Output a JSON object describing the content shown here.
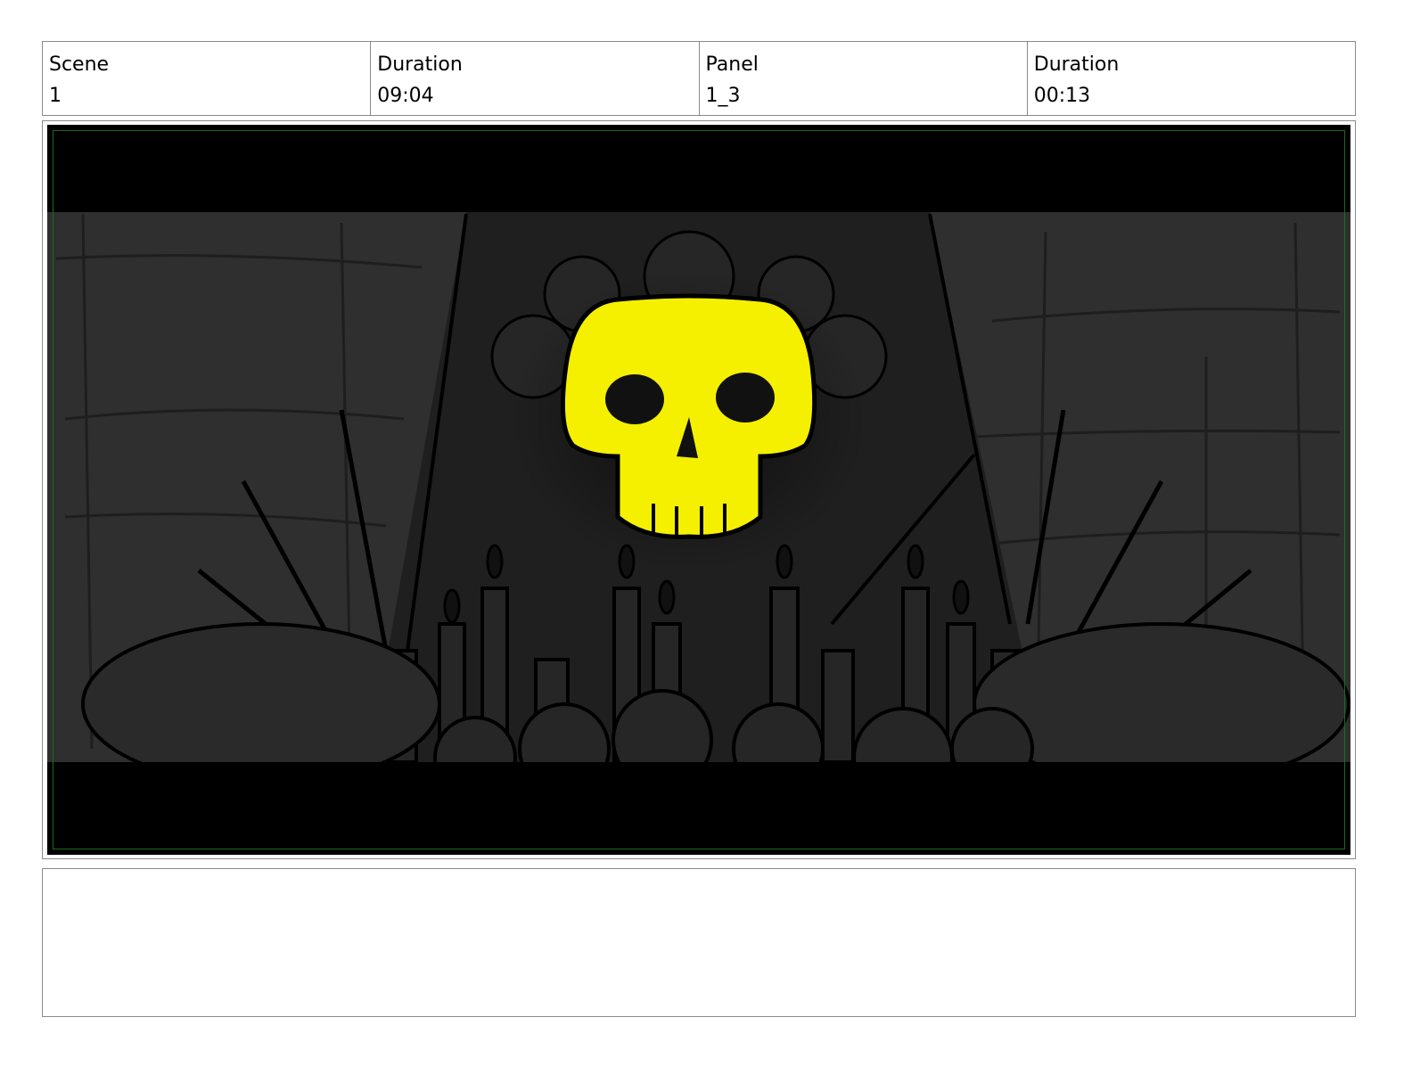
{
  "header": {
    "cells": [
      {
        "label": "Scene",
        "value": "1"
      },
      {
        "label": "Duration",
        "value": "09:04"
      },
      {
        "label": "Panel",
        "value": "1_3"
      },
      {
        "label": "Duration",
        "value": "00:13"
      }
    ]
  },
  "frame": {
    "image_subject": "yellow-skull-altar-icon"
  },
  "notes": {
    "text": ""
  },
  "colors": {
    "skull": "#f5f000",
    "scene_bg": "#2f2f2f",
    "letterbox": "#000000",
    "safe_frame": "#1d6a1d",
    "border": "#8a8a8a"
  }
}
